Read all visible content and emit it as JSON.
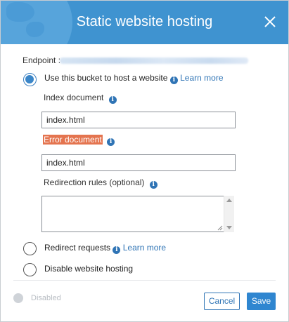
{
  "dialog": {
    "title": "Static website hosting",
    "endpoint_label": "Endpoint :"
  },
  "options": {
    "host": {
      "label": "Use this bucket to host a website",
      "learn_more": "Learn more",
      "selected": true
    },
    "redirect": {
      "label": "Redirect requests",
      "learn_more": "Learn more",
      "selected": false
    },
    "disable": {
      "label": "Disable website hosting",
      "selected": false
    }
  },
  "fields": {
    "index_document": {
      "label": "Index document",
      "value": "index.html"
    },
    "error_document": {
      "label": "Error document",
      "value": "index.html"
    },
    "redirection_rules": {
      "label": "Redirection rules (optional)",
      "value": ""
    }
  },
  "footer": {
    "status_label": "Disabled",
    "cancel_label": "Cancel",
    "save_label": "Save"
  },
  "icons": {
    "info": "i",
    "close": "close-icon"
  },
  "colors": {
    "header": "#3f93d0",
    "accent": "#2f74b5",
    "error_highlight": "#e4744f",
    "save_button": "#2f86d0"
  }
}
